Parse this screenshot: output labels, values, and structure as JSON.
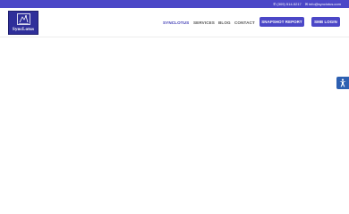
{
  "topbar": {
    "phone_icon": "phone-icon",
    "phone": "(309) 514-5217",
    "email_icon": "envelope-icon",
    "email": "info@synclotus.com"
  },
  "brand": {
    "logo_text": "SyncLotus",
    "logo_color": "#2f2f9a"
  },
  "nav": {
    "items": [
      {
        "label": "SYNCLOTUS",
        "active": true
      },
      {
        "label": "SERVICES",
        "active": false
      },
      {
        "label": "BLOG",
        "active": false
      },
      {
        "label": "CONTACT",
        "active": false
      }
    ]
  },
  "buttons": {
    "snapshot": "SNAPSHOT REPORT",
    "smb_login": "SMB LOGIN"
  },
  "accessibility": {
    "icon": "accessibility-icon"
  },
  "colors": {
    "accent": "#4b47c7",
    "accessibility_button": "#2c5fb1",
    "nav_text": "#555555",
    "nav_active": "#3d3ab3"
  }
}
